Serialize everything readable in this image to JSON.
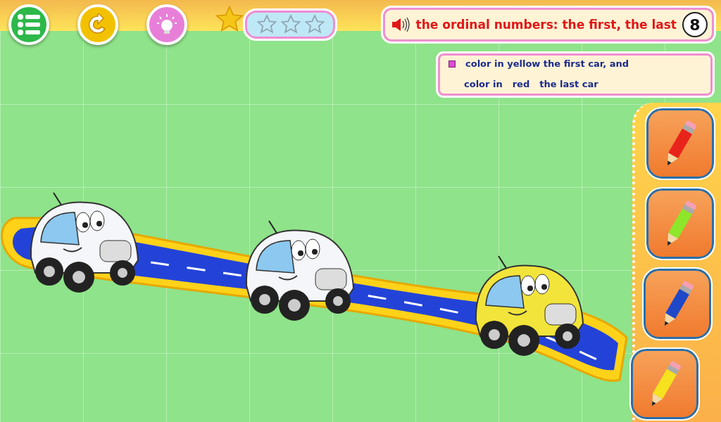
{
  "toolbar": {
    "buttons": [
      {
        "kind": "menu"
      },
      {
        "kind": "restart"
      },
      {
        "kind": "hint"
      }
    ]
  },
  "score": {
    "stars": 0
  },
  "title": {
    "text": "the ordinal numbers: the first, the last",
    "number": "8"
  },
  "instruction": {
    "line_1": "color in yellow the first car, and",
    "line_2": [
      "color in",
      "red",
      "the last car"
    ]
  },
  "cars": [
    {
      "color": "#f4f6fa"
    },
    {
      "color": "#f4f6fa"
    },
    {
      "color": "#f2e43a"
    }
  ],
  "pencils": [
    {
      "color": "#e8231b"
    },
    {
      "color": "#8ee62a"
    },
    {
      "color": "#1f48c8"
    },
    {
      "color": "#f6e21e"
    }
  ]
}
